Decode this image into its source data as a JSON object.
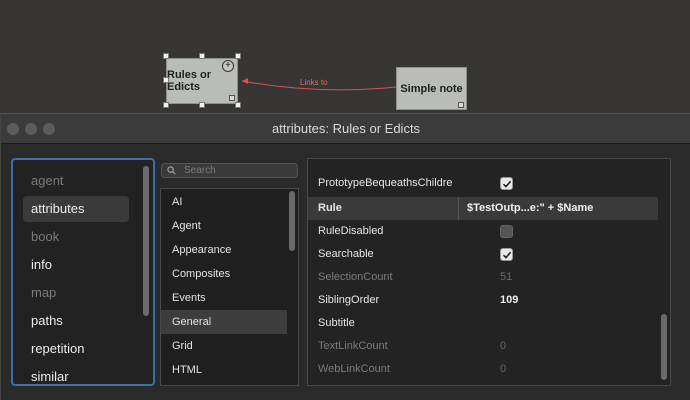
{
  "map": {
    "note_rules": "Rules or Edicts",
    "note_simple": "Simple note",
    "link_label": "Links to",
    "link_color": "#d9544c"
  },
  "window": {
    "title": "attributes: Rules or Edicts"
  },
  "categories": [
    {
      "label": "agent",
      "dim": true
    },
    {
      "label": "attributes",
      "selected": true
    },
    {
      "label": "book",
      "dim": true
    },
    {
      "label": "info"
    },
    {
      "label": "map",
      "dim": true
    },
    {
      "label": "paths"
    },
    {
      "label": "repetition"
    },
    {
      "label": "similar"
    }
  ],
  "search": {
    "placeholder": "Search"
  },
  "groups": [
    {
      "label": "AI"
    },
    {
      "label": "Agent"
    },
    {
      "label": "Appearance"
    },
    {
      "label": "Composites"
    },
    {
      "label": "Events"
    },
    {
      "label": "General",
      "selected": true
    },
    {
      "label": "Grid"
    },
    {
      "label": "HTML"
    }
  ],
  "attributes": [
    {
      "name": "PrototypeBequeathsChildre",
      "type": "checkbox",
      "checked": true
    },
    {
      "name": "Rule",
      "value": "$TestOutp...e:\" + $Name",
      "header": true
    },
    {
      "name": "RuleDisabled",
      "type": "checkbox",
      "checked": false
    },
    {
      "name": "Searchable",
      "type": "checkbox",
      "checked": true
    },
    {
      "name": "SelectionCount",
      "value": "51",
      "dim": true
    },
    {
      "name": "SiblingOrder",
      "value": "109"
    },
    {
      "name": "Subtitle",
      "value": ""
    },
    {
      "name": "TextLinkCount",
      "value": "0",
      "dim": true
    },
    {
      "name": "WebLinkCount",
      "value": "0",
      "dim": true
    }
  ]
}
